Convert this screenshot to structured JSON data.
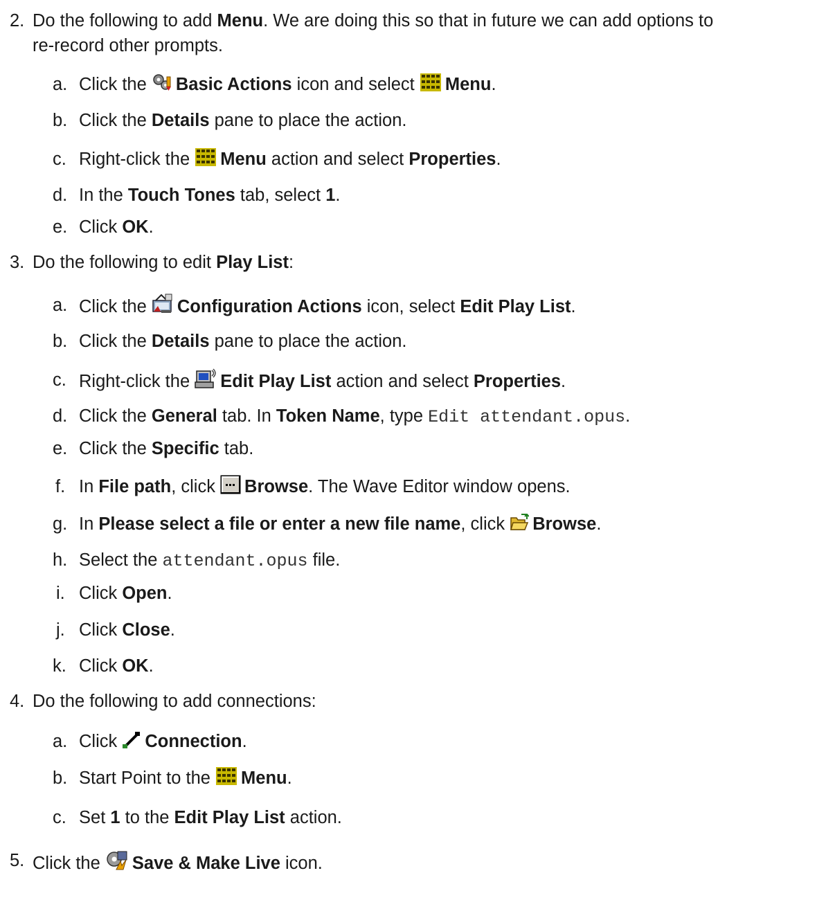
{
  "step2": {
    "num": "2.",
    "intro_a": "Do the following to add ",
    "intro_bold": "Menu",
    "intro_b": ". We are doing this so that in future we can add options to",
    "intro_c": "re-record other prompts.",
    "a": {
      "num": "a.",
      "t1": "Click the ",
      "b1": "Basic Actions",
      "t2": " icon and select ",
      "b2": "Menu",
      "t3": "."
    },
    "b": {
      "num": "b.",
      "t1": "Click the ",
      "b1": "Details",
      "t2": " pane to place the action."
    },
    "c": {
      "num": "c.",
      "t1": "Right-click the ",
      "b1": "Menu",
      "t2": " action and select ",
      "b2": "Properties",
      "t3": "."
    },
    "d": {
      "num": "d.",
      "t1": "In the ",
      "b1": "Touch Tones",
      "t2": " tab, select ",
      "b2": "1",
      "t3": "."
    },
    "e": {
      "num": "e.",
      "t1": "Click ",
      "b1": "OK",
      "t2": "."
    }
  },
  "step3": {
    "num": "3.",
    "intro_a": "Do the following to edit ",
    "intro_bold": "Play List",
    "intro_b": ":",
    "a": {
      "num": "a.",
      "t1": "Click the ",
      "b1": "Configuration Actions",
      "t2": " icon, select ",
      "b2": "Edit Play List",
      "t3": "."
    },
    "b": {
      "num": "b.",
      "t1": "Click the ",
      "b1": "Details",
      "t2": " pane to place the action."
    },
    "c": {
      "num": "c.",
      "t1": "Right-click the ",
      "b1": "Edit Play List",
      "t2": " action and select ",
      "b2": "Properties",
      "t3": "."
    },
    "d": {
      "num": "d.",
      "t1": "Click the ",
      "b1": "General",
      "t2": " tab. In ",
      "b2": "Token Name",
      "t3": ", type ",
      "code": "Edit attendant.opus",
      "t4": "."
    },
    "e": {
      "num": "e.",
      "t1": "Click the ",
      "b1": "Specific",
      "t2": " tab."
    },
    "f": {
      "num": "f.",
      "t1": "In ",
      "b1": "File path",
      "t2": ", click ",
      "b2": "Browse",
      "t3": ". The Wave Editor window opens."
    },
    "g": {
      "num": "g.",
      "t1": "In ",
      "b1": "Please select a file or enter a new file name",
      "t2": ", click ",
      "b2": "Browse",
      "t3": "."
    },
    "h": {
      "num": "h.",
      "t1": "Select the ",
      "code": "attendant.opus",
      "t2": " file."
    },
    "i": {
      "num": "i.",
      "t1": "Click ",
      "b1": "Open",
      "t2": "."
    },
    "j": {
      "num": "j.",
      "t1": "Click ",
      "b1": "Close",
      "t2": "."
    },
    "k": {
      "num": "k.",
      "t1": "Click ",
      "b1": "OK",
      "t2": "."
    }
  },
  "step4": {
    "num": "4.",
    "intro": "Do the following to add connections:",
    "a": {
      "num": "a.",
      "t1": "Click ",
      "b1": "Connection",
      "t2": "."
    },
    "b": {
      "num": "b.",
      "t1": "Start Point to the ",
      "b1": "Menu",
      "t2": "."
    },
    "c": {
      "num": "c.",
      "t1": "Set ",
      "b1": "1",
      "t2": " to the ",
      "b2": "Edit Play List",
      "t3": " action."
    }
  },
  "step5": {
    "num": "5.",
    "t1": "Click the ",
    "b1": "Save & Make Live",
    "t2": " icon."
  },
  "icons": {
    "basic_actions": "gears-icon",
    "menu": "menu-grid-icon",
    "configuration_actions": "configuration-icon",
    "edit_play_list": "edit-play-list-icon",
    "browse_dots": "ellipsis-button-icon",
    "browse_folder": "open-folder-icon",
    "connection": "connection-line-icon",
    "save_make_live": "save-make-live-icon"
  }
}
